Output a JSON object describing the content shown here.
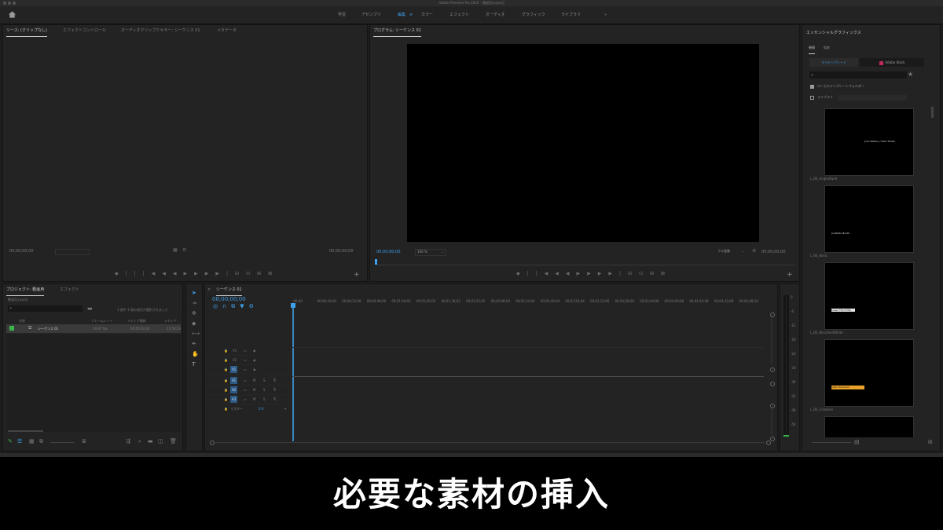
{
  "window": {
    "title": "Adobe Premiere Pro 2020 - [動画用.prproj]"
  },
  "workspaces": {
    "items": [
      "学習",
      "アセンブリ",
      "編集",
      "カラー",
      "エフェクト",
      "オーディオ",
      "グラフィック",
      "ライブラリ"
    ],
    "active": "編集",
    "more": "»"
  },
  "source_panel": {
    "tabs": [
      "ソース: (クリップなし)",
      "エフェクトコントロール",
      "オーディオクリップミキサー: シーケンス 01",
      "メタデータ"
    ],
    "timecode_left": "00;00;00;00",
    "timecode_right": "00;00;00;00"
  },
  "program_panel": {
    "tab": "プログラム: シーケンス 01",
    "timecode_left": "00;00;00;00",
    "zoom": "100 %",
    "quality": "フル画質",
    "timecode_right": "00;00;00;00"
  },
  "essential_graphics": {
    "title": "エッセンシャルグラフィックス",
    "tabs": [
      "参照",
      "編集"
    ],
    "buttons": [
      "マイテンプレート",
      "Adobe Stock"
    ],
    "search_placeholder": "",
    "local_folder": "ローカルテンプレートフォルダー",
    "library": "ライブラリ",
    "templates": [
      {
        "name": "L_BS_AngledSplit",
        "text": "John Watson / Main Street"
      },
      {
        "name": "L_BS_Basic",
        "text": "Jonathan Booth"
      },
      {
        "name": "L_BS_BlackAndWhite",
        "text": "Lower Third Title"
      },
      {
        "name": "L_BS_Colorbox",
        "text": "Justin Robinson"
      }
    ]
  },
  "project_panel": {
    "tabs": [
      "プロジェクト: 動画用",
      "エフェクト"
    ],
    "path": "動画用.prproj",
    "selection_info": "1 個中 1 個の項目が選択されました",
    "columns": [
      "名前",
      "フレームレート",
      "メディア開始",
      "メディア"
    ],
    "rows": [
      {
        "name": "シーケンス 01",
        "fps": "29.97 fps",
        "start": "00;00;00;00",
        "dur": "23;59;59"
      }
    ]
  },
  "timeline": {
    "tab": "シーケンス 01",
    "timecode": "00;00;00;00",
    "ruler": [
      ":00;00",
      "00;00;16;00",
      "00;00;32;00",
      "00;00;48;00",
      "00;01;04;02",
      "00;01;20;02",
      "00;01;36;02",
      "00;01;52;02",
      "00;02;08;04",
      "00;02;24;04",
      "00;02;40;04",
      "00;02;56;04",
      "00;03;12;06",
      "00;03;28;06",
      "00;03;44;06",
      "00;04;00;08",
      "00;04;16;08",
      "00;04;32;08",
      "00;04;48;10"
    ],
    "video_tracks": [
      "V3",
      "V2",
      "V1"
    ],
    "audio_tracks": [
      "A1",
      "A2",
      "A3"
    ],
    "master_label": "マスター",
    "master_value": "0.0"
  },
  "meter_scale": [
    "0",
    "-6",
    "-12",
    "-18",
    "-24",
    "-30",
    "-36",
    "-42",
    "-48",
    "-54"
  ],
  "subtitle": "必要な素材の挿入",
  "colors": {
    "accent": "#3f9fe8",
    "panel": "#232323",
    "background": "#1d1d1d"
  }
}
